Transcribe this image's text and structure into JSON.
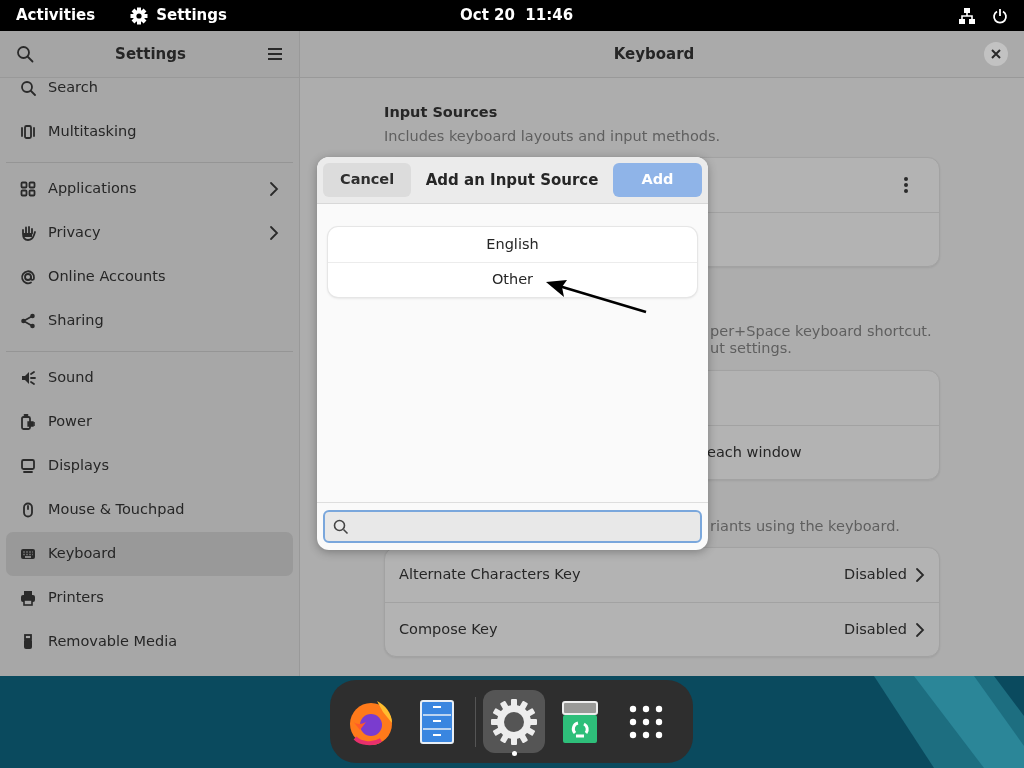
{
  "top_bar": {
    "activities": "Activities",
    "app": "Settings",
    "clock": "Oct 20  11:46"
  },
  "sidebar": {
    "title": "Settings",
    "groups": [
      [
        {
          "label": "Search",
          "kind": "page",
          "selected": false
        },
        {
          "label": "Multitasking",
          "kind": "page",
          "selected": false
        }
      ],
      [
        {
          "label": "Applications",
          "kind": "submenu",
          "selected": false
        },
        {
          "label": "Privacy",
          "kind": "submenu",
          "selected": false
        },
        {
          "label": "Online Accounts",
          "kind": "page",
          "selected": false
        },
        {
          "label": "Sharing",
          "kind": "page",
          "selected": false
        }
      ],
      [
        {
          "label": "Sound",
          "kind": "page",
          "selected": false
        },
        {
          "label": "Power",
          "kind": "page",
          "selected": false
        },
        {
          "label": "Displays",
          "kind": "page",
          "selected": false
        },
        {
          "label": "Mouse & Touchpad",
          "kind": "page",
          "selected": false
        },
        {
          "label": "Keyboard",
          "kind": "page",
          "selected": true
        },
        {
          "label": "Printers",
          "kind": "page",
          "selected": false
        },
        {
          "label": "Removable Media",
          "kind": "page",
          "selected": false
        }
      ]
    ]
  },
  "main": {
    "title": "Keyboard",
    "sections": [
      {
        "heading": "Input Sources",
        "description": [
          "Includes keyboard layouts and input methods."
        ],
        "rows": [
          {
            "kind": "menu"
          },
          {
            "kind": "blank"
          }
        ]
      },
      {
        "description": [
          "per+Space keyboard shortcut.",
          "ut settings."
        ],
        "rows": [
          {
            "kind": "blank"
          },
          {
            "kind": "label",
            "label": "each window"
          }
        ]
      },
      {
        "description": [
          "riants using the keyboard."
        ],
        "rows": [
          {
            "kind": "value",
            "label": "Alternate Characters Key",
            "value": "Disabled"
          },
          {
            "kind": "value",
            "label": "Compose Key",
            "value": "Disabled"
          }
        ]
      }
    ]
  },
  "dialog": {
    "title": "Add an Input Source",
    "cancel": "Cancel",
    "add": {
      "label": "Add",
      "disabled": true
    },
    "options": [
      {
        "label": "English"
      },
      {
        "label": "Other"
      }
    ],
    "search": {
      "focused": true
    },
    "annotation": {
      "kind": "arrow"
    }
  },
  "dock": {
    "groups": [
      [
        {
          "kind": "browser",
          "selected": false,
          "running": false
        },
        {
          "kind": "files",
          "selected": false,
          "running": false
        }
      ],
      [
        {
          "kind": "settings",
          "selected": true,
          "running": true
        },
        {
          "kind": "trash",
          "selected": false,
          "running": false
        },
        {
          "kind": "apps",
          "selected": false,
          "running": false
        }
      ]
    ]
  }
}
